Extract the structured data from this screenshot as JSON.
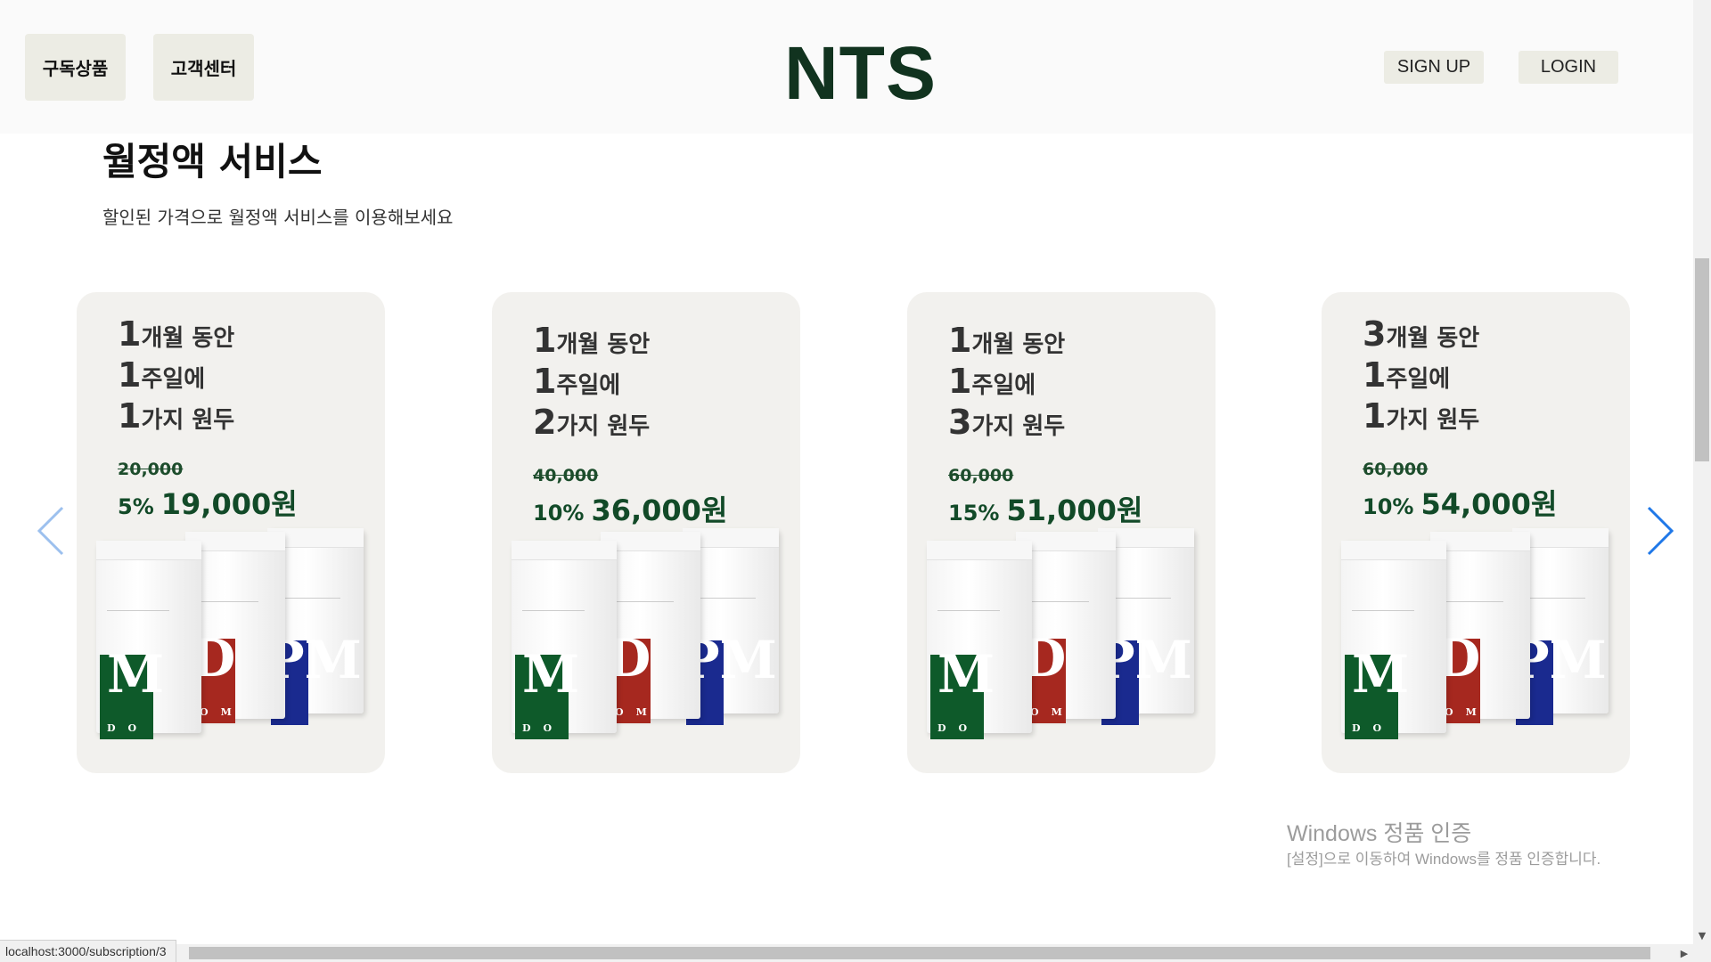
{
  "header": {
    "nav": [
      "구독상품",
      "고객센터"
    ],
    "logo": "NTS",
    "signup": "SIGN UP",
    "login": "LOGIN"
  },
  "main": {
    "title": "월정액 서비스",
    "subtitle": "할인된 가격으로 월정액 서비스를 이용해보세요"
  },
  "cards": [
    {
      "months": "1",
      "months_label": "개월 동안",
      "weeks": "1",
      "weeks_label": "주일에",
      "kinds": "1",
      "kinds_label": "가지 원두",
      "original_price": "20,000",
      "discount": "5%",
      "price": "19,000원"
    },
    {
      "months": "1",
      "months_label": "개월 동안",
      "weeks": "1",
      "weeks_label": "주일에",
      "kinds": "2",
      "kinds_label": "가지 원두",
      "original_price": "40,000",
      "discount": "10%",
      "price": "36,000원"
    },
    {
      "months": "1",
      "months_label": "개월 동안",
      "weeks": "1",
      "weeks_label": "주일에",
      "kinds": "3",
      "kinds_label": "가지 원두",
      "original_price": "60,000",
      "discount": "15%",
      "price": "51,000원"
    },
    {
      "months": "3",
      "months_label": "개월 동안",
      "weeks": "1",
      "weeks_label": "주일에",
      "kinds": "1",
      "kinds_label": "가지 원두",
      "original_price": "60,000",
      "discount": "10%",
      "price": "54,000원"
    }
  ],
  "bag_labels": [
    {
      "big": "M",
      "small": "DO",
      "color": "#0e5a2a"
    },
    {
      "big": "D",
      "small": "OM",
      "color": "#a6281f"
    },
    {
      "big": "PM",
      "small": "",
      "color": "#1a2a8f"
    }
  ],
  "carousel": {
    "prev_icon": "chevron-left-icon",
    "next_icon": "chevron-right-icon",
    "accent": "#1f78e8"
  },
  "watermark": {
    "title": "Windows 정품 인증",
    "subtitle": "[설정]으로 이동하여 Windows를 정품 인증합니다."
  },
  "status_bar": {
    "url": "localhost:3000/subscription/3"
  },
  "colors": {
    "header_bg": "#fafafa",
    "button_bg": "#ecece4",
    "card_bg": "#f2f1ee",
    "price_green": "#124a28",
    "logo": "#11331f"
  }
}
